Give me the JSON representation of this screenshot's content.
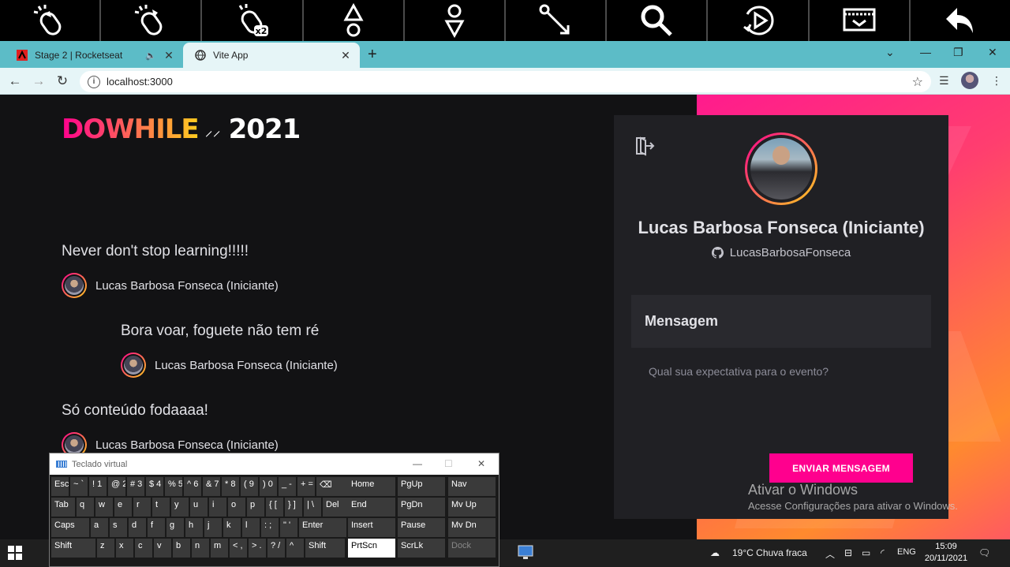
{
  "mouse_toolbar": {
    "buttons": [
      {
        "name": "left-click-icon",
        "label": ""
      },
      {
        "name": "right-click-icon",
        "label": ""
      },
      {
        "name": "double-click-icon",
        "label": "x2"
      },
      {
        "name": "scroll-up-icon",
        "label": ""
      },
      {
        "name": "scroll-down-icon",
        "label": ""
      },
      {
        "name": "drag-icon",
        "label": ""
      },
      {
        "name": "magnifier-icon",
        "label": ""
      },
      {
        "name": "play-icon",
        "label": ""
      },
      {
        "name": "keyboard-toggle-icon",
        "label": ""
      },
      {
        "name": "back-arrow-icon",
        "label": ""
      }
    ]
  },
  "browser": {
    "tabs": [
      {
        "title": "Stage 2 | Rocketseat",
        "active": false,
        "audio": true
      },
      {
        "title": "Vite App",
        "active": true,
        "audio": false
      }
    ],
    "new_tab": "+",
    "url": "localhost:3000"
  },
  "page": {
    "logo": {
      "text_left": "DOWHILE",
      "text_right": "2021"
    },
    "messages": [
      {
        "text": "Never don't stop learning!!!!!",
        "user": "Lucas Barbosa Fonseca (Iniciante)"
      },
      {
        "text": "Bora voar, foguete não tem ré",
        "user": "Lucas Barbosa Fonseca (Iniciante)"
      },
      {
        "text": "Só conteúdo fodaaaa!",
        "user": "Lucas Barbosa Fonseca (Iniciante)"
      }
    ],
    "profile": {
      "name": "Lucas Barbosa Fonseca (Iniciante)",
      "github": "LucasBarbosaFonseca"
    },
    "form": {
      "header": "Mensagem",
      "placeholder": "Qual sua expectativa para o evento?",
      "button": "ENVIAR MENSAGEM"
    }
  },
  "watermark": {
    "title": "Ativar o Windows",
    "subtitle": "Acesse Configurações para ativar o Windows."
  },
  "virtual_keyboard": {
    "title": "Teclado virtual",
    "row1": [
      "Esc",
      "~ `",
      "! 1",
      "@ 2",
      "# 3",
      "$ 4",
      "% 5",
      "^ 6",
      "& 7",
      "* 8",
      "( 9",
      ") 0",
      "_ -",
      "+ =",
      "⌫"
    ],
    "row2": [
      "Tab",
      "q",
      "w",
      "e",
      "r",
      "t",
      "y",
      "u",
      "i",
      "o",
      "p",
      "{ [",
      "} ]",
      "| \\",
      "Del"
    ],
    "row3": [
      "Caps",
      "a",
      "s",
      "d",
      "f",
      "g",
      "h",
      "j",
      "k",
      "l",
      ": ;",
      "\" '",
      "Enter"
    ],
    "row4": [
      "Shift",
      "z",
      "x",
      "c",
      "v",
      "b",
      "n",
      "m",
      "< ,",
      "> .",
      "? /",
      "^",
      "Shift"
    ],
    "nav": [
      [
        "Home",
        "PgUp",
        "Nav"
      ],
      [
        "End",
        "PgDn",
        "Mv Up"
      ],
      [
        "Insert",
        "Pause",
        "Mv Dn"
      ],
      [
        "PrtScn",
        "ScrLk",
        "Dock"
      ]
    ]
  },
  "taskbar": {
    "weather": "19°C  Chuva fraca",
    "language": "ENG",
    "time": "15:09",
    "date": "20/11/2021"
  }
}
